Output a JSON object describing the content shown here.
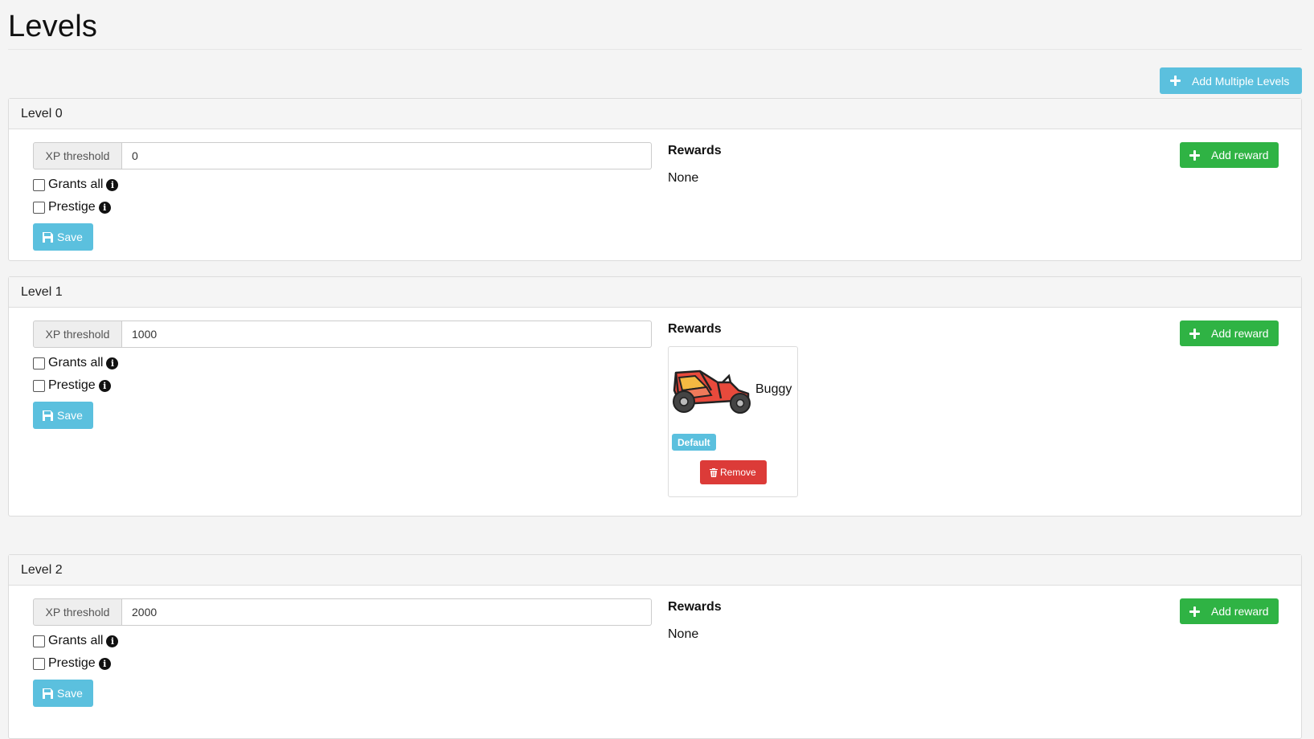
{
  "page": {
    "title": "Levels",
    "add_multiple_label": "Add Multiple Levels"
  },
  "colors": {
    "info": "#5bc0de",
    "success": "#2fb344",
    "danger": "#dc3b38"
  },
  "levels": [
    {
      "title": "Level 0",
      "xp_label": "XP threshold",
      "xp_value": "0",
      "grants_all_label": "Grants all",
      "prestige_label": "Prestige",
      "grants_all_checked": false,
      "prestige_checked": false,
      "save_label": "Save",
      "rewards_heading": "Rewards",
      "rewards_empty": "None",
      "add_reward_label": "Add reward"
    },
    {
      "title": "Level 1",
      "xp_label": "XP threshold",
      "xp_value": "1000",
      "grants_all_label": "Grants all",
      "prestige_label": "Prestige",
      "grants_all_checked": false,
      "prestige_checked": false,
      "save_label": "Save",
      "rewards_heading": "Rewards",
      "add_reward_label": "Add reward",
      "rewards": [
        {
          "name": "Buggy",
          "icon": "buggy-icon",
          "badge": "Default",
          "remove_label": "Remove"
        }
      ]
    },
    {
      "title": "Level 2",
      "xp_label": "XP threshold",
      "xp_value": "2000",
      "grants_all_label": "Grants all",
      "prestige_label": "Prestige",
      "grants_all_checked": false,
      "prestige_checked": false,
      "save_label": "Save",
      "rewards_heading": "Rewards",
      "rewards_empty": "None",
      "add_reward_label": "Add reward"
    }
  ]
}
